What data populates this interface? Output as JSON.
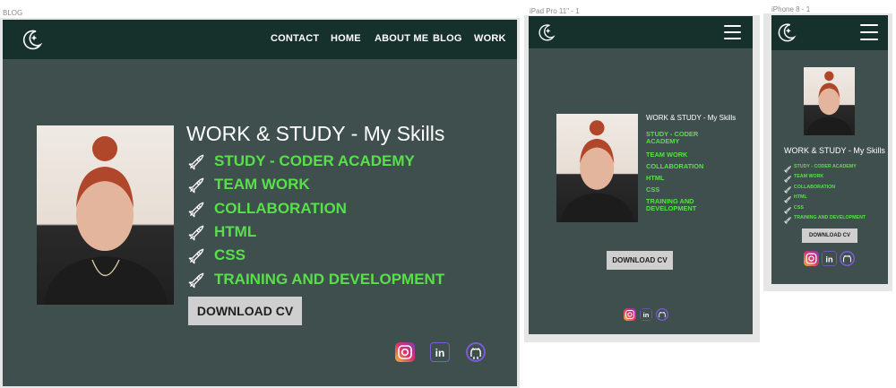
{
  "frames": {
    "desktop": "BLOG",
    "tablet": "iPad Pro 11\" - 1",
    "mobile": "iPhone 8 - 1"
  },
  "nav": {
    "links": [
      "CONTACT",
      "HOME",
      "ABOUT ME",
      "BLOG",
      "WORK"
    ]
  },
  "content": {
    "title": "WORK & STUDY - My Skills",
    "skills": [
      "STUDY - CODER ACADEMY",
      "TEAM WORK",
      "COLLABORATION",
      "HTML",
      "CSS",
      "TRAINING AND DEVELOPMENT"
    ],
    "button": "DOWNLOAD CV"
  },
  "social": {
    "icons": [
      "instagram-icon",
      "linkedin-icon",
      "github-icon"
    ],
    "linkedin_glyph": "in"
  },
  "colors": {
    "background": "#3f4f4d",
    "nav": "#16302c",
    "accent": "#58e04a",
    "button": "#cfcfcf"
  }
}
